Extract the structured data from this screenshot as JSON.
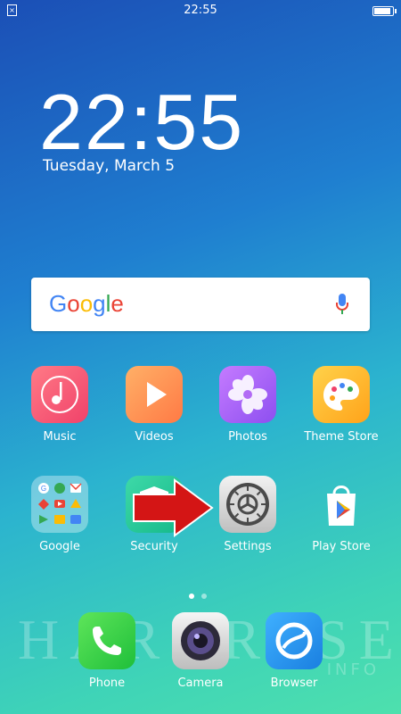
{
  "status_bar": {
    "time": "22:55",
    "battery_level": 0.9
  },
  "lockscreen": {
    "clock": "22:55",
    "date": "Tuesday, March 5"
  },
  "search_bar": {
    "logo": "Google",
    "mic_icon": "mic-icon"
  },
  "apps": [
    {
      "label": "Music",
      "icon": "music-note-icon"
    },
    {
      "label": "Videos",
      "icon": "play-icon"
    },
    {
      "label": "Photos",
      "icon": "flower-icon"
    },
    {
      "label": "Theme Store",
      "icon": "palette-icon"
    },
    {
      "label": "Google",
      "icon": "google-folder-icon"
    },
    {
      "label": "Security",
      "icon": "shield-icon"
    },
    {
      "label": "Settings",
      "icon": "gear-icon"
    },
    {
      "label": "Play Store",
      "icon": "play-store-icon"
    }
  ],
  "dock": [
    {
      "label": "Phone",
      "icon": "phone-icon"
    },
    {
      "label": "Camera",
      "icon": "camera-icon"
    },
    {
      "label": "Browser",
      "icon": "browser-icon"
    }
  ],
  "pager": {
    "pages": 2,
    "current": 1
  },
  "watermark": {
    "text": "HARDRESET",
    "suffix": "INFO"
  },
  "colors": {
    "google_blue": "#4285F4",
    "google_red": "#EA4335",
    "google_yellow": "#FBBC05",
    "google_green": "#34A853",
    "arrow_red": "#d41515"
  }
}
